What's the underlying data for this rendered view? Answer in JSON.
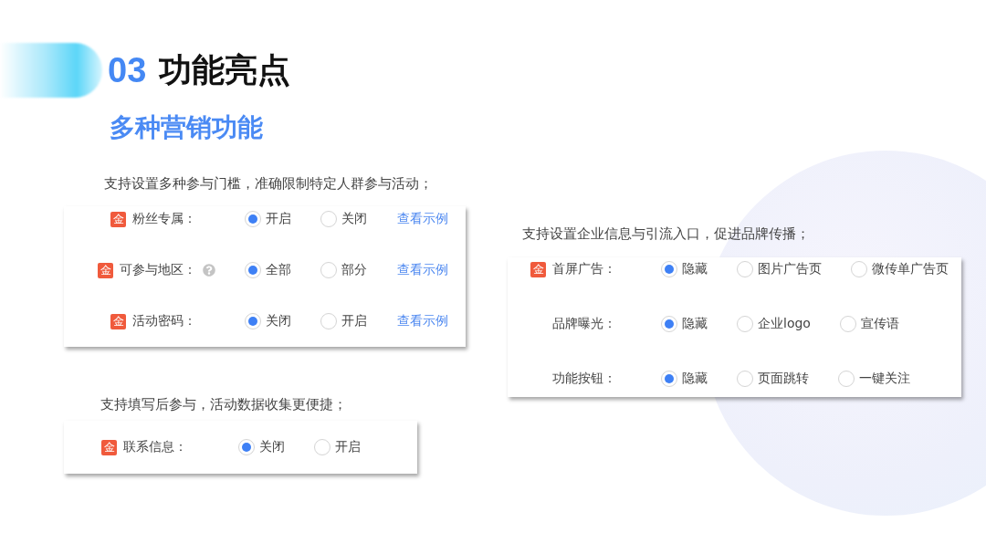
{
  "header": {
    "number": "03",
    "title": "功能亮点",
    "subtitle": "多种营销功能"
  },
  "left": [
    {
      "caption": "支持设置多种参与门槛，准确限制特定人群参与活动；",
      "rows": [
        {
          "badge": "金",
          "label": "粉丝专属：",
          "help": false,
          "options": [
            {
              "label": "开启",
              "selected": true
            },
            {
              "label": "关闭",
              "selected": false
            }
          ],
          "link": "查看示例"
        },
        {
          "badge": "金",
          "label": "可参与地区：",
          "help": true,
          "options": [
            {
              "label": "全部",
              "selected": true
            },
            {
              "label": "部分",
              "selected": false
            }
          ],
          "link": "查看示例"
        },
        {
          "badge": "金",
          "label": "活动密码：",
          "help": false,
          "options": [
            {
              "label": "关闭",
              "selected": true
            },
            {
              "label": "开启",
              "selected": false
            }
          ],
          "link": "查看示例"
        }
      ]
    },
    {
      "caption": "支持填写后参与，活动数据收集更便捷；",
      "rows": [
        {
          "badge": "金",
          "label": "联系信息：",
          "help": false,
          "options": [
            {
              "label": "关闭",
              "selected": true
            },
            {
              "label": "开启",
              "selected": false
            }
          ]
        }
      ]
    }
  ],
  "right": [
    {
      "caption": "支持设置企业信息与引流入口，促进品牌传播；",
      "rows": [
        {
          "badge": "金",
          "label": "首屏广告：",
          "options": [
            {
              "label": "隐藏",
              "selected": true
            },
            {
              "label": "图片广告页",
              "selected": false
            },
            {
              "label": "微传单广告页",
              "selected": false
            }
          ]
        },
        {
          "label": "品牌曝光：",
          "options": [
            {
              "label": "隐藏",
              "selected": true
            },
            {
              "label": "企业logo",
              "selected": false
            },
            {
              "label": "宣传语",
              "selected": false
            }
          ]
        },
        {
          "label": "功能按钮：",
          "options": [
            {
              "label": "隐藏",
              "selected": true
            },
            {
              "label": "页面跳转",
              "selected": false
            },
            {
              "label": "一键关注",
              "selected": false
            }
          ]
        }
      ]
    }
  ]
}
